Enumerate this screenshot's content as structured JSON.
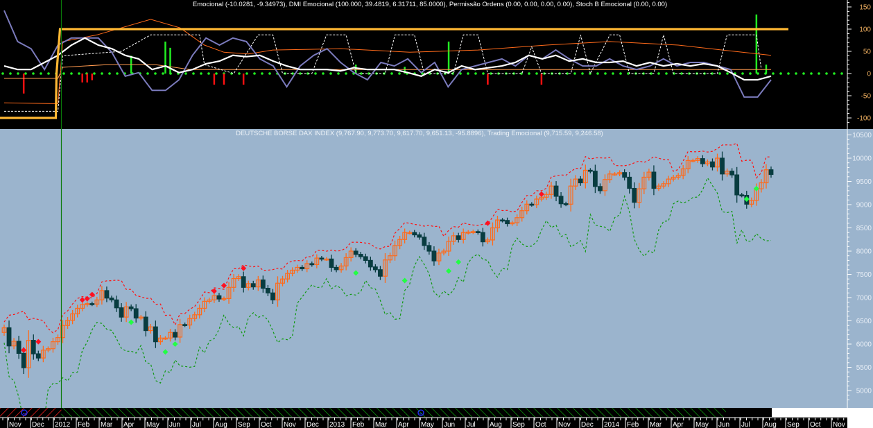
{
  "colors": {
    "top_bg": "#000000",
    "price_bg": "#9bb4cd",
    "up_candle": "#ff6a1a",
    "down_candle": "#083c40",
    "emocional": "#ffffff",
    "dmi": "#7b7bbd",
    "permissao": "#ffb833",
    "signal": "#ff6a1a",
    "zero_dots": "#22ee22",
    "upper_band": "#ff1010",
    "lower_band": "#119911",
    "sell_marker": "#ff1020",
    "buy_marker": "#22ff44",
    "top_axis_text": "#f0b060",
    "price_axis_text": "#e8eef6"
  },
  "chart_data": [
    {
      "type": "line",
      "title": "Emocional (-10.0281, -9.34973), DMI Emocional (100.000, 39.4819, 6.31711, 85.0000), Permissão Ordens (0.00, 0.00, 0.00, 0.00), Stoch B Emocional (0.00, 0.00)",
      "ylim": [
        -115,
        165
      ],
      "yticks": [
        "150",
        "100",
        "50",
        "0",
        "-50",
        "-100"
      ],
      "ytick_values": [
        150,
        100,
        50,
        0,
        -50,
        -100
      ],
      "span_weeks": [
        0,
        157
      ],
      "emocional": [
        17,
        9,
        9,
        25,
        41,
        64,
        80,
        64,
        56,
        41,
        33,
        9,
        17,
        2,
        9,
        22,
        28,
        41,
        38,
        41,
        28,
        17,
        9,
        9,
        9,
        6,
        13,
        9,
        9,
        9,
        2,
        -6,
        9,
        2,
        17,
        9,
        13,
        17,
        25,
        41,
        33,
        41,
        28,
        33,
        25,
        25,
        28,
        17,
        25,
        17,
        22,
        17,
        22,
        17,
        2,
        -14,
        -14,
        -6
      ],
      "dmi": [
        142,
        72,
        56,
        9,
        64,
        80,
        80,
        80,
        48,
        -6,
        2,
        -38,
        -38,
        -14,
        41,
        80,
        64,
        80,
        72,
        33,
        17,
        -30,
        17,
        41,
        56,
        25,
        2,
        -14,
        25,
        17,
        33,
        2,
        25,
        -30,
        9,
        17,
        25,
        33,
        17,
        41,
        33,
        53,
        33,
        17,
        17,
        33,
        17,
        9,
        17,
        33,
        17,
        25,
        25,
        17,
        9,
        -53,
        -53,
        -14
      ],
      "permissao_step": {
        "switch_week": 11,
        "before": -100,
        "after": 100
      },
      "signal_line": [
        [
          0,
          -66
        ],
        [
          11,
          -68
        ],
        [
          12,
          72
        ],
        [
          19,
          87
        ],
        [
          30,
          122
        ],
        [
          36,
          103
        ],
        [
          41,
          64
        ],
        [
          45,
          48
        ],
        [
          50,
          44
        ],
        [
          55,
          53
        ],
        [
          69,
          56
        ],
        [
          83,
          48
        ],
        [
          97,
          53
        ],
        [
          111,
          64
        ],
        [
          124,
          72
        ],
        [
          138,
          64
        ],
        [
          147,
          53
        ],
        [
          157,
          41
        ]
      ],
      "base_line": [
        [
          0,
          -11
        ],
        [
          11,
          -11
        ],
        [
          12,
          14
        ],
        [
          21,
          20
        ],
        [
          31,
          20
        ],
        [
          38,
          9
        ],
        [
          157,
          9
        ]
      ],
      "stoch": [
        [
          0,
          -85
        ],
        [
          11,
          -85
        ],
        [
          12,
          40
        ],
        [
          24,
          50
        ],
        [
          30,
          87
        ],
        [
          40,
          87
        ],
        [
          41,
          20
        ],
        [
          47,
          0
        ],
        [
          52,
          87
        ],
        [
          55,
          87
        ],
        [
          57,
          0
        ],
        [
          63,
          0
        ],
        [
          66,
          87
        ],
        [
          70,
          87
        ],
        [
          72,
          0
        ],
        [
          78,
          0
        ],
        [
          80,
          87
        ],
        [
          84,
          87
        ],
        [
          86,
          0
        ],
        [
          92,
          0
        ],
        [
          94,
          87
        ],
        [
          97,
          87
        ],
        [
          99,
          0
        ],
        [
          106,
          0
        ],
        [
          108,
          60
        ],
        [
          110,
          0
        ],
        [
          116,
          0
        ],
        [
          118,
          87
        ],
        [
          120,
          0
        ],
        [
          124,
          87
        ],
        [
          126,
          87
        ],
        [
          128,
          0
        ],
        [
          133,
          0
        ],
        [
          135,
          87
        ],
        [
          137,
          0
        ],
        [
          146,
          0
        ],
        [
          148,
          87
        ],
        [
          154,
          87
        ],
        [
          155,
          10
        ]
      ],
      "histogram": [
        [
          4,
          -45
        ],
        [
          16,
          -20
        ],
        [
          17,
          -20
        ],
        [
          18,
          -15
        ],
        [
          26,
          40
        ],
        [
          33,
          72
        ],
        [
          34,
          58
        ],
        [
          43,
          -25
        ],
        [
          45,
          -25
        ],
        [
          49,
          -25
        ],
        [
          72,
          20
        ],
        [
          82,
          15
        ],
        [
          91,
          72
        ],
        [
          99,
          -25
        ],
        [
          110,
          -25
        ],
        [
          154,
          133
        ],
        [
          156,
          20
        ]
      ]
    },
    {
      "type": "candlestick",
      "title": "DEUTSCHE BORSE DAX INDEX (9,767.90, 9,773.70, 9,617.70, 9,651.13, -95.8896), Trading Emocional (9,715.59, 9,246.58)",
      "ylim": [
        4700,
        10600
      ],
      "yticks": [
        "10500",
        "10000",
        "9500",
        "9000",
        "8500",
        "8000",
        "7500",
        "7000",
        "6500",
        "6000",
        "5500",
        "5000"
      ],
      "ytick_values": [
        10500,
        10000,
        9500,
        9000,
        8500,
        8000,
        7500,
        7000,
        6500,
        6000,
        5500,
        5000
      ],
      "weekly_close": [
        6350,
        5960,
        6060,
        5800,
        5490,
        6080,
        5790,
        5700,
        5870,
        5900,
        6050,
        6140,
        6400,
        6510,
        6650,
        6770,
        6850,
        6870,
        6860,
        6950,
        7150,
        6990,
        6950,
        6780,
        6580,
        6800,
        6760,
        6560,
        6580,
        6290,
        6370,
        6050,
        6130,
        6130,
        6250,
        6150,
        6420,
        6410,
        6550,
        6630,
        6770,
        6920,
        6950,
        7040,
        6970,
        6980,
        7220,
        7410,
        7450,
        7220,
        7300,
        7230,
        7380,
        7200,
        7100,
        6950,
        7310,
        7400,
        7520,
        7590,
        7650,
        7620,
        7730,
        7710,
        7850,
        7830,
        7830,
        7650,
        7600,
        7680,
        7860,
        8000,
        7930,
        7880,
        7800,
        7660,
        7600,
        7460,
        7810,
        7900,
        8120,
        8250,
        8400,
        8400,
        8350,
        8300,
        8120,
        8000,
        7790,
        7960,
        8000,
        8210,
        8330,
        8250,
        8400,
        8410,
        8420,
        8400,
        8200,
        8240,
        8500,
        8670,
        8660,
        8590,
        8610,
        8720,
        8870,
        9010,
        9000,
        9120,
        9160,
        9220,
        9400,
        9180,
        9020,
        9010,
        9400,
        9550,
        9470,
        9740,
        9720,
        9390,
        9300,
        9540,
        9660,
        9660,
        9690,
        9590,
        9350,
        9050,
        9340,
        9590,
        9700,
        9350,
        9400,
        9450,
        9550,
        9590,
        9630,
        9770,
        9950,
        9950,
        9990,
        9880,
        9920,
        9810,
        10000,
        9660,
        9720,
        9640,
        9210,
        9200,
        9010,
        9090,
        9340,
        9470,
        9750,
        9650
      ],
      "first_open": 6250,
      "sell_signals": [
        [
          4,
          5870
        ],
        [
          7,
          6050
        ],
        [
          16,
          6950
        ],
        [
          17,
          6975
        ],
        [
          18,
          7065
        ],
        [
          43,
          7140
        ],
        [
          45,
          7260
        ],
        [
          49,
          7630
        ],
        [
          99,
          8600
        ],
        [
          110,
          9225
        ]
      ],
      "buy_signals": [
        [
          26,
          6470
        ],
        [
          33,
          5830
        ],
        [
          35,
          6000
        ],
        [
          72,
          7530
        ],
        [
          82,
          7365
        ],
        [
          91,
          7570
        ],
        [
          93,
          7765
        ],
        [
          152,
          9120
        ],
        [
          154,
          9345
        ]
      ],
      "marker_week": 11
    }
  ],
  "x_axis": {
    "months": [
      "Nov",
      "Dec",
      "2012",
      "Feb",
      "Mar",
      "Apr",
      "May",
      "Jun",
      "Jul",
      "Aug",
      "Sep",
      "Oct",
      "Nov",
      "Dec",
      "2013",
      "Feb",
      "Mar",
      "Apr",
      "May",
      "Jun",
      "Jul",
      "Aug",
      "Sep",
      "Oct",
      "Nov",
      "Dec",
      "2014",
      "Feb",
      "Mar",
      "Apr",
      "May",
      "Jun",
      "Jul",
      "Aug",
      "Sep",
      "Oct",
      "Nov"
    ]
  },
  "status_icons": [
    "smiley-icon",
    "smiley-icon",
    "smiley-icon"
  ]
}
